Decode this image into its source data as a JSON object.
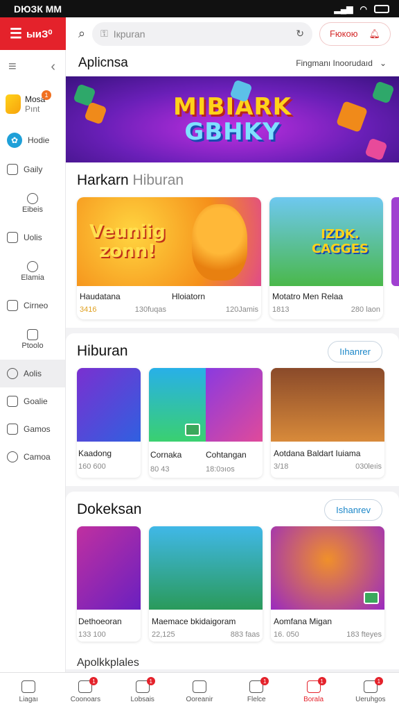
{
  "status_bar": {
    "time": "DЮЗК ММ"
  },
  "brand": {
    "label": "ыиЗ⁰"
  },
  "search": {
    "placeholder": "Ікрuran"
  },
  "top_action": {
    "label": "Fюкою"
  },
  "sidebar": {
    "special_1": {
      "label_line1": "Mosa",
      "label_line2": "Pınt",
      "badge": "1"
    },
    "special_2": {
      "label": "Hodie"
    },
    "items": [
      {
        "label": "Gaily",
        "icon": "square-icon"
      },
      {
        "label": "Eibeis",
        "icon": "user-icon"
      },
      {
        "label": "Uolis",
        "icon": "home-icon"
      },
      {
        "label": "Elamia",
        "icon": "search-icon"
      },
      {
        "label": "Cirneo",
        "icon": "grid-icon"
      },
      {
        "label": "Ptoolo",
        "icon": "image-icon"
      },
      {
        "label": "Aolis",
        "icon": "circle-icon"
      },
      {
        "label": "Goalie",
        "icon": "list-icon"
      },
      {
        "label": "Gamos",
        "icon": "calendar-icon"
      },
      {
        "label": "Camoa",
        "icon": "chat-icon"
      }
    ]
  },
  "app_head": {
    "title": "Aplicnsa",
    "sort_label": "Fingmanı Inoorudaıd"
  },
  "banner": {
    "line1": "MIBIARK",
    "line2": "GBHKY"
  },
  "section1": {
    "title": "Harkarn",
    "title_light": "Hiburan",
    "cards": [
      {
        "art": "Veuniig zonn!",
        "title": "Haudatana",
        "meta_left": "3416",
        "meta_right": "130fuqas"
      },
      {
        "art": "",
        "title": "Hloiatorn",
        "meta_left": "",
        "meta_right": "120Jamis"
      },
      {
        "art": "IZDK. CAGGES",
        "title": "Motatro Men Relaa",
        "meta_left": "1813",
        "meta_right": "280 laon"
      }
    ]
  },
  "section2": {
    "title": "Hiburan",
    "more": "Iıhanrer",
    "cards": [
      {
        "title": "Kaadong",
        "meta": "160 600"
      },
      {
        "title": "Cornaka",
        "meta": "80 43"
      },
      {
        "title": "Cohtangan",
        "meta": "18:0эıos"
      },
      {
        "title": "Aotdana Baldart Iuiama",
        "meta_left": "3/18",
        "meta_right": "030leıis"
      }
    ]
  },
  "section3": {
    "title": "Dokeksan",
    "more": "Ishanrev",
    "cards": [
      {
        "title": "Dethoeoran",
        "meta": "133 100"
      },
      {
        "title": "Maemace bkidaigoram",
        "meta_left": "22,125",
        "meta_right": "883 faas"
      },
      {
        "title": "Aomfana Migan",
        "meta_left": "16. 050",
        "meta_right": "183 fteyes"
      }
    ]
  },
  "footer_label": "Apolkkplales",
  "bottom_nav": [
    {
      "label": "Liagaı",
      "badge": ""
    },
    {
      "label": "Coonoars",
      "badge": "1"
    },
    {
      "label": "Lobsais",
      "badge": "1"
    },
    {
      "label": "Ooreanir",
      "badge": ""
    },
    {
      "label": "Flelce",
      "badge": "1"
    },
    {
      "label": "Borala",
      "badge": "1"
    },
    {
      "label": "Ueruhgos",
      "badge": "1"
    }
  ],
  "colors": {
    "brand_red": "#e4222b",
    "accent_blue": "#1a86c8"
  }
}
